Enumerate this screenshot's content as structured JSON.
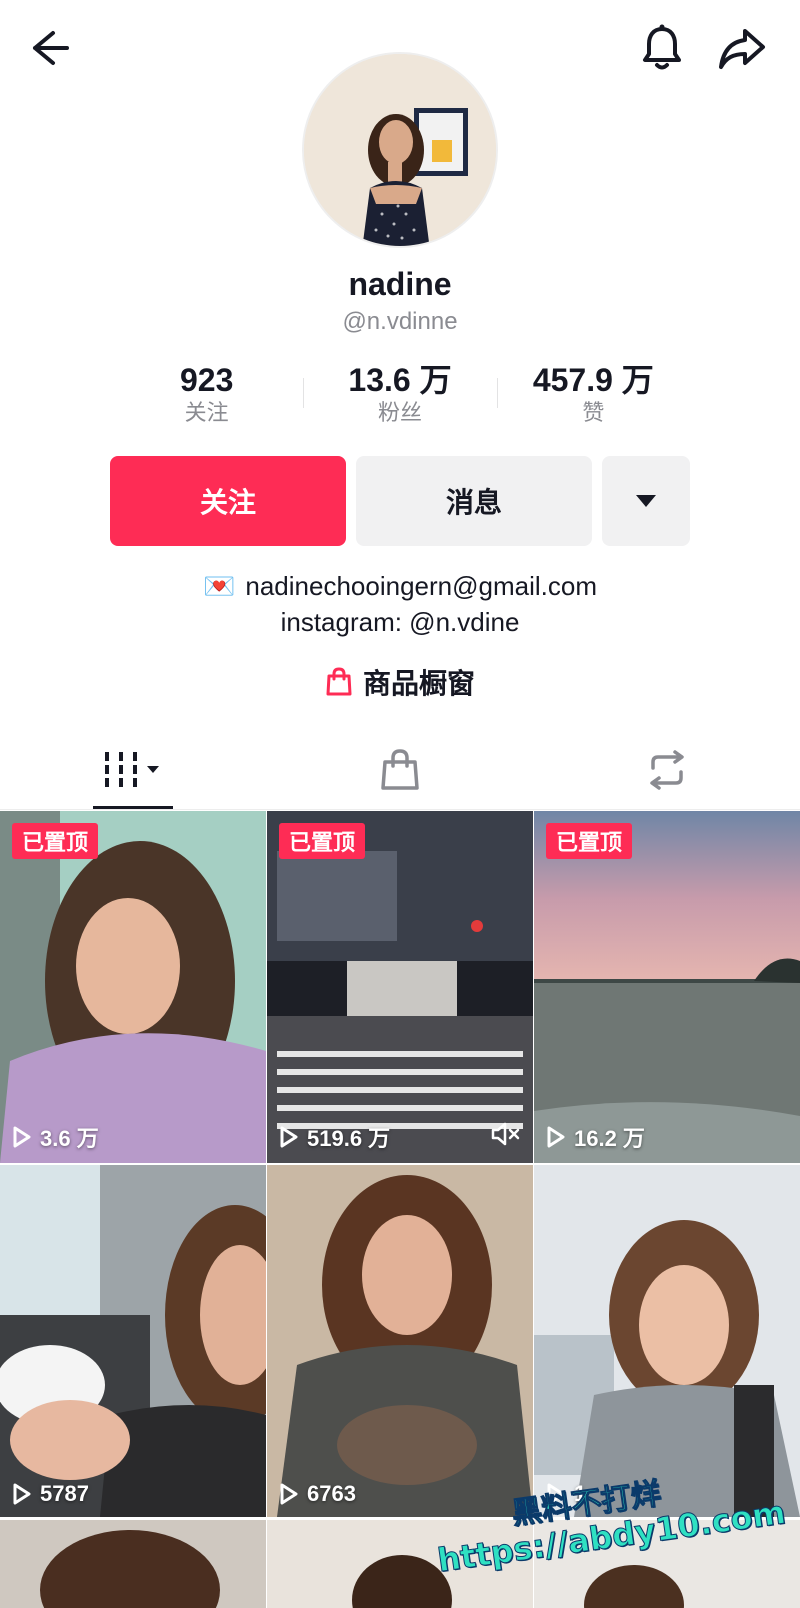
{
  "profile": {
    "name": "nadine",
    "handle": "@n.vdinne"
  },
  "stats": [
    {
      "value": "923",
      "label": "关注"
    },
    {
      "value": "13.6 万",
      "label": "粉丝"
    },
    {
      "value": "457.9 万",
      "label": "赞"
    }
  ],
  "actions": {
    "follow_label": "关注",
    "message_label": "消息"
  },
  "bio": {
    "email_emoji": "💌",
    "email": "nadinechooingern@gmail.com",
    "instagram": "instagram: @n.vdine"
  },
  "shop": {
    "label": "商品橱窗"
  },
  "tabs": [
    {
      "icon": "videos-grid-icon",
      "active": true
    },
    {
      "icon": "shopping-bag-icon",
      "active": false
    },
    {
      "icon": "repost-icon",
      "active": false
    }
  ],
  "videos": [
    {
      "pinned_label": "已置顶",
      "plays": "3.6 万"
    },
    {
      "pinned_label": "已置顶",
      "plays": "519.6 万"
    },
    {
      "pinned_label": "已置顶",
      "plays": "16.2 万"
    },
    {
      "plays": "5787"
    },
    {
      "plays": "6763"
    },
    {
      "plays": "1"
    }
  ],
  "watermark": {
    "line1": "黑料不打烊",
    "line2": "https://abdy10.com"
  },
  "colors": {
    "accent": "#fe2c55",
    "text": "#161823",
    "muted": "#8a8b91",
    "button_gray": "#f1f1f2"
  }
}
